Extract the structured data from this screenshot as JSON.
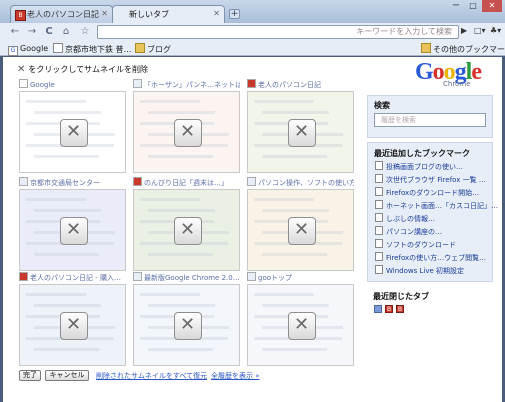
{
  "tabs": [
    {
      "title": "老人のパソコン日記",
      "favicon": "blog-icon",
      "active": false
    },
    {
      "title": "新しいタブ",
      "active": true
    }
  ],
  "window": {
    "minimize": "ー",
    "maximize": "□",
    "close": "✕"
  },
  "toolbar": {
    "back": "←",
    "forward": "→",
    "reload": "C",
    "home": "⌂",
    "star": "☆",
    "omnibox_placeholder": "キーワードを入力して検索",
    "go": "▶",
    "page_menu": "□▾",
    "tools_menu": "♣▾"
  },
  "bookmarks_bar": {
    "items": [
      {
        "label": "Google",
        "icon": "google-icon"
      },
      {
        "label": "京都市地下鉄 普…",
        "icon": "page-icon"
      },
      {
        "label": "ブログ",
        "icon": "folder-icon"
      }
    ],
    "other": "その他のブックマーク"
  },
  "remove_hint": "をクリックしてサムネイルを削除",
  "logo": {
    "word": "Google",
    "sub": "Chrome",
    "colors": [
      "#2a5ad8",
      "#d6302a",
      "#e8b400",
      "#2a5ad8",
      "#2c9a3b",
      "#d6302a"
    ]
  },
  "thumbnails": [
    {
      "title": "Google",
      "favicon": "google",
      "bg": "#ffffff"
    },
    {
      "title": "「ホーザン」パンネ…ネットは店…",
      "favicon": "page",
      "bg": "#f3e3d8"
    },
    {
      "title": "老人のパソコン日記",
      "favicon": "blog",
      "bg": "#dde7c8"
    },
    {
      "title": "京都市交通局センター",
      "favicon": "page",
      "bg": "#c9d0ee"
    },
    {
      "title": "のんびり日記「週末は…」",
      "favicon": "blog",
      "bg": "#c8d8b8"
    },
    {
      "title": "パソコン操作、ソフトの使い方…",
      "favicon": "page",
      "bg": "#f0e0c0"
    },
    {
      "title": "老人のパソコン日記 - 購入…",
      "favicon": "blog",
      "bg": "#d2dcee"
    },
    {
      "title": "最新版Google Chrome 2.0…",
      "favicon": "page",
      "bg": "#e0e6f5"
    },
    {
      "title": "gooトップ",
      "favicon": "page",
      "bg": "#e4eaf2"
    }
  ],
  "search": {
    "heading": "検索",
    "placeholder": "履歴を検索"
  },
  "recent_bookmarks": {
    "heading": "最近追加したブックマーク",
    "items": [
      "投稿画面ブログの使い…",
      "次世代ブラウザ Firefox 一覧 …",
      "Firefoxのダウンロード開始…",
      "ホーネット画面…「カスコ日記」…",
      "しぶしの情報…",
      "パソコン講座の…",
      "ソフトのダウンロード",
      "Firefoxの使い方…ウェブ閲覧…",
      "Windows Live 初期設定"
    ]
  },
  "closed_tabs": {
    "heading": "最近閉じたタブ"
  },
  "footer": {
    "done": "完了",
    "cancel": "キャンセル",
    "restore": "削除されたサムネイルをすべて復元",
    "history": "全履歴を表示 »"
  }
}
